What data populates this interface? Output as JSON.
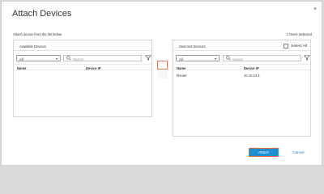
{
  "dialog": {
    "title": "Attach Devices",
    "close_glyph": "×",
    "subtitle": "Attach device from the list below",
    "selected_count": "1 Items Selected"
  },
  "available": {
    "title": "Available Devices",
    "filter_value": "All",
    "search_placeholder": "Search",
    "columns": [
      "Name",
      "Device IP"
    ],
    "rows": []
  },
  "selected": {
    "title": "Selected Devices",
    "select_all_label": "Select All",
    "filter_value": "All",
    "search_placeholder": "Search",
    "columns": [
      "Name",
      "Device IP"
    ],
    "rows": [
      {
        "name": "Router",
        "ip": "10.10.10.1"
      }
    ]
  },
  "footer": {
    "attach_label": "Attach",
    "cancel_label": "Cancel"
  },
  "icons": {
    "search": "search-icon",
    "filter": "filter-icon",
    "chevron": "chevron-down-icon",
    "close": "close-icon"
  },
  "colors": {
    "primary": "#1f8fd4",
    "link": "#1f78c8",
    "focus_outline": "#e8603a"
  }
}
